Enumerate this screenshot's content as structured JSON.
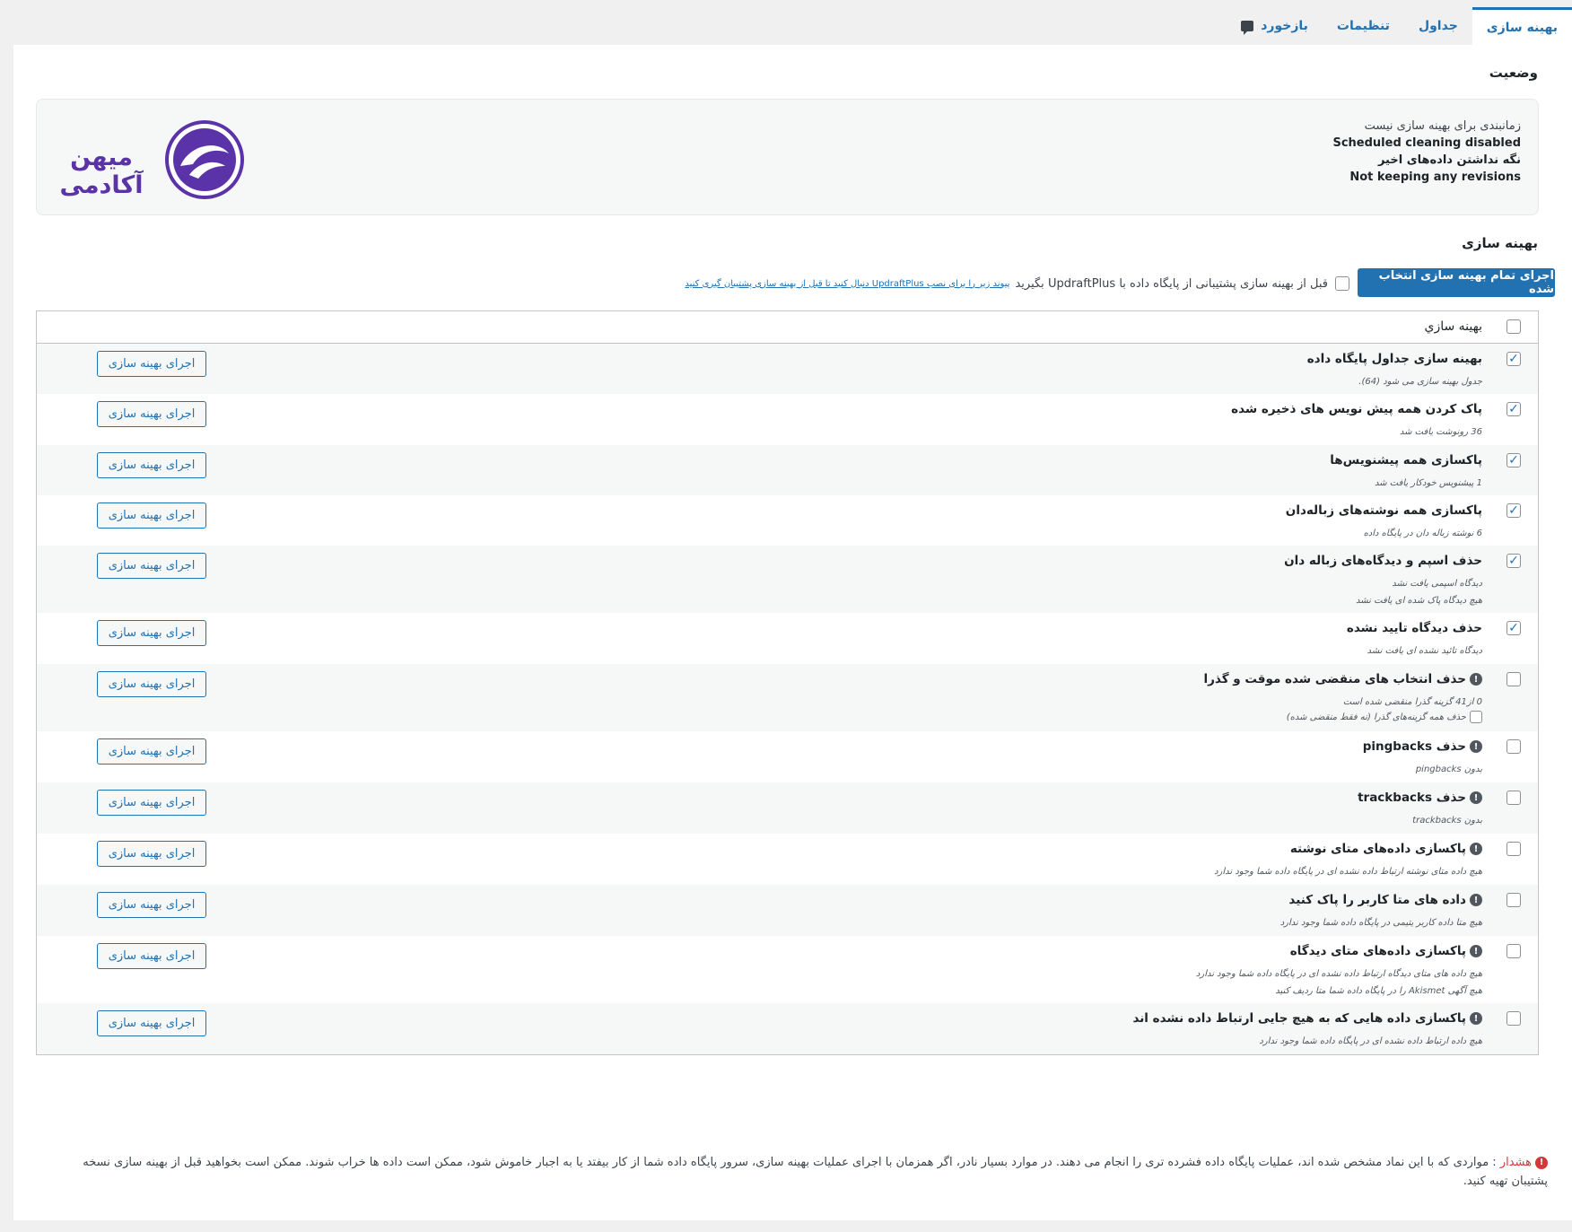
{
  "tabs": [
    {
      "label": "بهینه سازی",
      "active": true
    },
    {
      "label": "جداول",
      "active": false
    },
    {
      "label": "تنظیمات",
      "active": false
    },
    {
      "label": "بازخورد",
      "active": false,
      "icon": "comment-icon"
    }
  ],
  "status": {
    "heading": "وضعیت",
    "lines": [
      "زمانبندی برای بهینه سازی نیست",
      "Scheduled cleaning disabled",
      "نگه نداشتن داده‌های اخیر",
      "Not keeping any revisions"
    ],
    "logo_text": "میهن آکادمی"
  },
  "optimizations": {
    "heading": "بهینه سازی",
    "run_all_label": "اجرای تمام بهینه سازی انتخاب شده",
    "backup_text": "قبل از بهینه سازی پشتیبانی از پایگاه داده با UpdraftPlus بگیرید",
    "backup_link": "پیوند زیر را برای نصب UpdraftPlus دنبال کنید تا قبل از بهینه سازی پشتیبان گیری کنید",
    "header_label": "بهینه سازي",
    "run_label": "اجرای بهینه سازی",
    "rows": [
      {
        "name": "بهینه سازی جداول پایگاه داده",
        "checked": true,
        "warn": false,
        "info": [
          "جدول بهینه سازی می شود (64)."
        ]
      },
      {
        "name": "پاک کردن همه پیش نویس های ذخیره شده",
        "checked": true,
        "warn": false,
        "info": [
          "36 رونوشت یافت شد"
        ]
      },
      {
        "name": "پاکسازی همه پیشنویس‌ها",
        "checked": true,
        "warn": false,
        "info": [
          "1 پیشنویس خودکار یافت شد"
        ]
      },
      {
        "name": "پاکسازی همه نوشته‌های زباله‌دان",
        "checked": true,
        "warn": false,
        "info": [
          "6 نوشته زباله دان در پایگاه داده"
        ]
      },
      {
        "name": "حذف اسپم و دیدگاه‌های زباله دان",
        "checked": true,
        "warn": false,
        "info": [
          "دیدگاه اسپمی یافت نشد",
          "هیچ دیدگاه پاک شده ای یافت نشد"
        ]
      },
      {
        "name": "حذف دیدگاه تایید نشده",
        "checked": true,
        "warn": false,
        "info": [
          "دیدگاه تائید نشده ای یافت نشد"
        ]
      },
      {
        "name": "حذف انتخاب های منقضی شده موقت و گذرا",
        "checked": false,
        "warn": true,
        "info": [
          "0 از41 گزینه گذرا منقضی شده است"
        ],
        "sub_option": "حذف همه گزینه‌های گذرا (نه فقط منقضی شده)"
      },
      {
        "name": "حذف pingbacks",
        "checked": false,
        "warn": true,
        "info": [
          "بدون pingbacks"
        ]
      },
      {
        "name": "حذف trackbacks",
        "checked": false,
        "warn": true,
        "info": [
          "بدون trackbacks"
        ]
      },
      {
        "name": "پاکسازی داده‌های متای نوشته",
        "checked": false,
        "warn": true,
        "info": [
          "هیچ داده متای نوشته ارتباط داده نشده ای در پایگاه داده شما وجود ندارد"
        ]
      },
      {
        "name": "داده های متا کاربر را پاک کنید",
        "checked": false,
        "warn": true,
        "info": [
          "هیچ متا داده کاربر یتیمی در پایگاه داده شما وجود ندارد"
        ]
      },
      {
        "name": "پاکسازی داده‌های متای دیدگاه",
        "checked": false,
        "warn": true,
        "info": [
          "هیچ داده های متای دیدگاه ارتباط داده نشده ای در پایگاه داده شما وجود ندارد",
          "هیچ آگهی Akismet را در پایگاه داده شما متا ردیف کنید"
        ]
      },
      {
        "name": "پاکسازی داده هایی که به هیچ جایی ارتباط داده نشده اند",
        "checked": false,
        "warn": true,
        "info": [
          "هیچ داده ارتباط داده نشده ای در پایگاه داده شما وجود ندارد"
        ]
      }
    ]
  },
  "warning": {
    "label": "هشدار",
    "text": ": مواردی که با این نماد مشخص شده اند، عملیات پایگاه داده فشرده تری را انجام می دهند. در موارد بسیار نادر، اگر همزمان با اجرای عملیات بهینه سازی، سرور پایگاه داده شما از کار بیفتد یا به اجبار خاموش شود، ممکن است داده ها خراب شوند. ممکن است بخواهید قبل از بهینه سازی نسخه پشتیبان تهیه کنید."
  },
  "colors": {
    "accent": "#2271b1",
    "danger": "#d63638",
    "logo": "#5b33a8"
  }
}
